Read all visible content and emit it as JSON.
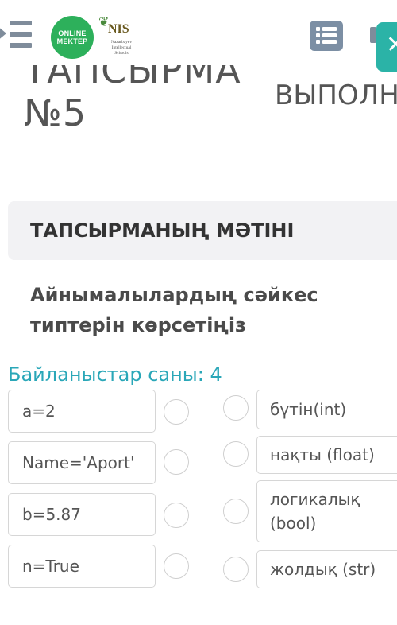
{
  "header": {
    "logo_online": [
      "ONLINE",
      "MEKTEP"
    ],
    "logo_nis": "NIS",
    "logo_nis_sub": [
      "Nazarbayev",
      "Intellectual",
      "Schools"
    ],
    "icons": [
      "menu-icon",
      "list-icon",
      "close-icon"
    ],
    "close_symbol": "✕"
  },
  "title": {
    "line1": "ТАПСЫРМА",
    "line2": "№5",
    "status": "ВЫПОЛН"
  },
  "task": {
    "section_title": "ТАПСЫРМАНЫҢ МӘТІНІ",
    "question": "Айнымалылардың сәйкес типтерін көрсетіңіз",
    "connections": "Байланыстар саны: 4"
  },
  "matching": {
    "left": [
      "a=2",
      "Name='Aport'",
      "b=5.87",
      "n=True"
    ],
    "right": [
      "бүтін(int)",
      "нақты (float)",
      "логикалық (bool)",
      "жолдық (str)"
    ]
  },
  "colors": {
    "accent": "#2bb3a7",
    "connections_text": "#2aa7b8",
    "logo_green": "#2db05b",
    "icon_gray": "#7c8fa4"
  }
}
